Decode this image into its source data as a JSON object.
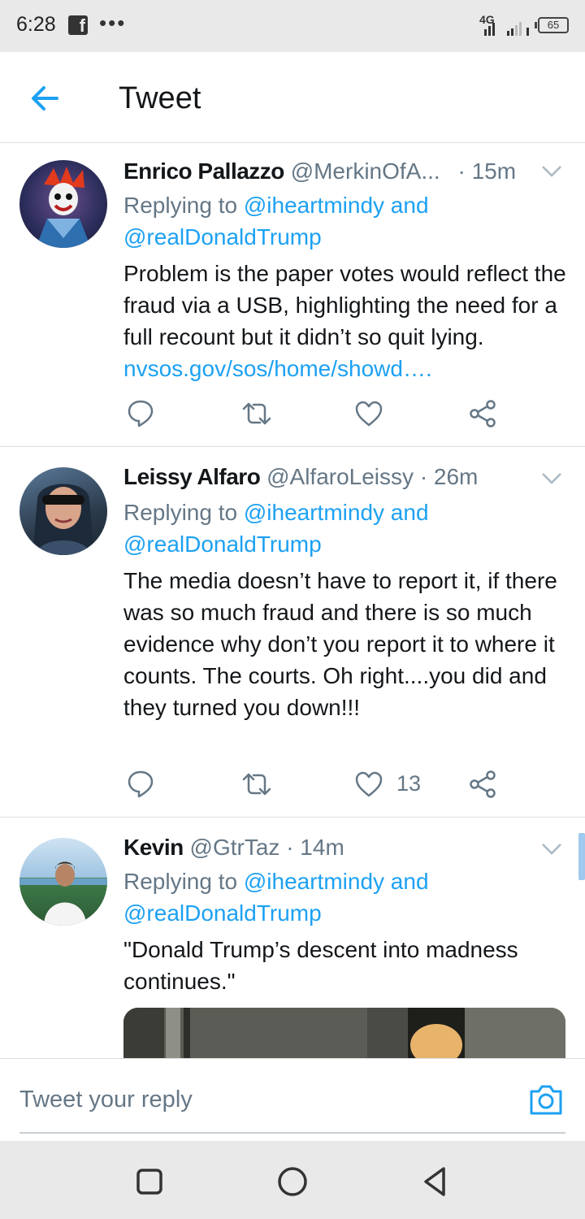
{
  "status_bar": {
    "time": "6:28",
    "app_icon": "facebook-icon",
    "more": "•••",
    "network": "4G",
    "battery": "65"
  },
  "header": {
    "back_icon": "arrow-left-icon",
    "title": "Tweet"
  },
  "tweets": [
    {
      "name": "Enrico Pallazzo",
      "handle": "@MerkinOfA...",
      "time": "· 15m",
      "replying_prefix": "Replying to ",
      "replying_to": "@iheartmindy and @realDonaldTrump",
      "text": "Problem is the paper votes would reflect the fraud via a USB, highlighting the need for a full recount but it didn’t so quit lying.",
      "link": "nvsos.gov/sos/home/showd….",
      "like_count": ""
    },
    {
      "name": "Leissy Alfaro",
      "handle": "@AlfaroLeissy",
      "time": "· 26m",
      "replying_prefix": "Replying to ",
      "replying_to": "@iheartmindy and @realDonaldTrump",
      "text": "The media doesn’t have to report it, if there was so much fraud and there is so much evidence why don’t you report it to where it counts. The courts. Oh right....you did and they turned you down!!!",
      "like_count": "13"
    },
    {
      "name": "Kevin",
      "handle": "@GtrTaz",
      "time": "· 14m",
      "replying_prefix": "Replying to ",
      "replying_to": "@iheartmindy and @realDonaldTrump",
      "text": "\"Donald Trump’s descent into madness continues.\""
    }
  ],
  "reply_box": {
    "placeholder": "Tweet your reply",
    "camera_icon": "camera-icon"
  },
  "colors": {
    "accent": "#1da1f2",
    "secondary_text": "#657786",
    "primary_text": "#14171a"
  }
}
